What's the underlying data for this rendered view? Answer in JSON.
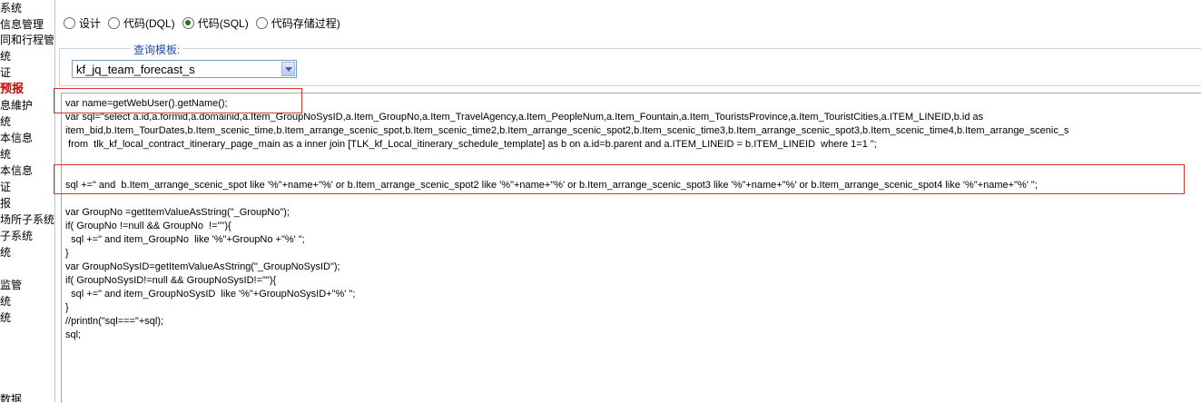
{
  "sidebar": {
    "items": [
      {
        "label": "系统"
      },
      {
        "label": "信息管理"
      },
      {
        "label": "同和行程管"
      },
      {
        "label": "统"
      },
      {
        "label": "证"
      },
      {
        "label": "预报",
        "active": true
      },
      {
        "label": "息維护"
      },
      {
        "label": "统"
      },
      {
        "label": "本信息"
      },
      {
        "label": "统"
      },
      {
        "label": "本信息"
      },
      {
        "label": "证"
      },
      {
        "label": "报"
      },
      {
        "label": "场所子系统"
      },
      {
        "label": "子系统"
      },
      {
        "label": "统"
      },
      {
        "label": "监管"
      },
      {
        "label": "统"
      },
      {
        "label": "统"
      },
      {
        "label": "数据"
      }
    ]
  },
  "modes": [
    {
      "label": "设计",
      "checked": false
    },
    {
      "label": "代码(DQL)",
      "checked": false
    },
    {
      "label": "代码(SQL)",
      "checked": true
    },
    {
      "label": "代码存储过程)",
      "checked": false
    }
  ],
  "query_template": {
    "legend": "查询模板:",
    "selected": "kf_jq_team_forecast_s"
  },
  "code": {
    "lines": [
      "var name=getWebUser().getName();",
      "var sql=\"select a.id,a.formid,a.domainid,a.Item_GroupNoSysID,a.Item_GroupNo,a.Item_TravelAgency,a.Item_PeopleNum,a.Item_Fountain,a.Item_TouristsProvince,a.Item_TouristCities,a.ITEM_LINEID,b.id as",
      "item_bid,b.Item_TourDates,b.Item_scenic_time,b.Item_arrange_scenic_spot,b.Item_scenic_time2,b.Item_arrange_scenic_spot2,b.Item_scenic_time3,b.Item_arrange_scenic_spot3,b.Item_scenic_time4,b.Item_arrange_scenic_s",
      " from  tlk_kf_local_contract_itinerary_page_main as a inner join [TLK_kf_Local_itinerary_schedule_template] as b on a.id=b.parent and a.ITEM_LINEID = b.ITEM_LINEID  where 1=1 \";",
      "",
      "",
      "sql +=\" and  b.Item_arrange_scenic_spot like '%\"+name+\"%' or b.Item_arrange_scenic_spot2 like '%\"+name+\"%' or b.Item_arrange_scenic_spot3 like '%\"+name+\"%' or b.Item_arrange_scenic_spot4 like '%\"+name+\"%' \";",
      "",
      "var GroupNo =getItemValueAsString(\"_GroupNo\");",
      "if( GroupNo !=null && GroupNo  !=\"\"){",
      "  sql +=\" and item_GroupNo  like '%\"+GroupNo +\"%' \";",
      "}",
      "var GroupNoSysID=getItemValueAsString(\"_GroupNoSysID\");",
      "if( GroupNoSysID!=null && GroupNoSysID!=\"\"){",
      "  sql +=\" and item_GroupNoSysID  like '%\"+GroupNoSysID+\"%' \";",
      "}",
      "//println(\"sql===\"+sql);",
      "sql;"
    ]
  },
  "colors": {
    "highlight_box": "#d9352b",
    "legend_text": "#1f4ea6",
    "active_sidebar": "#d00000"
  }
}
